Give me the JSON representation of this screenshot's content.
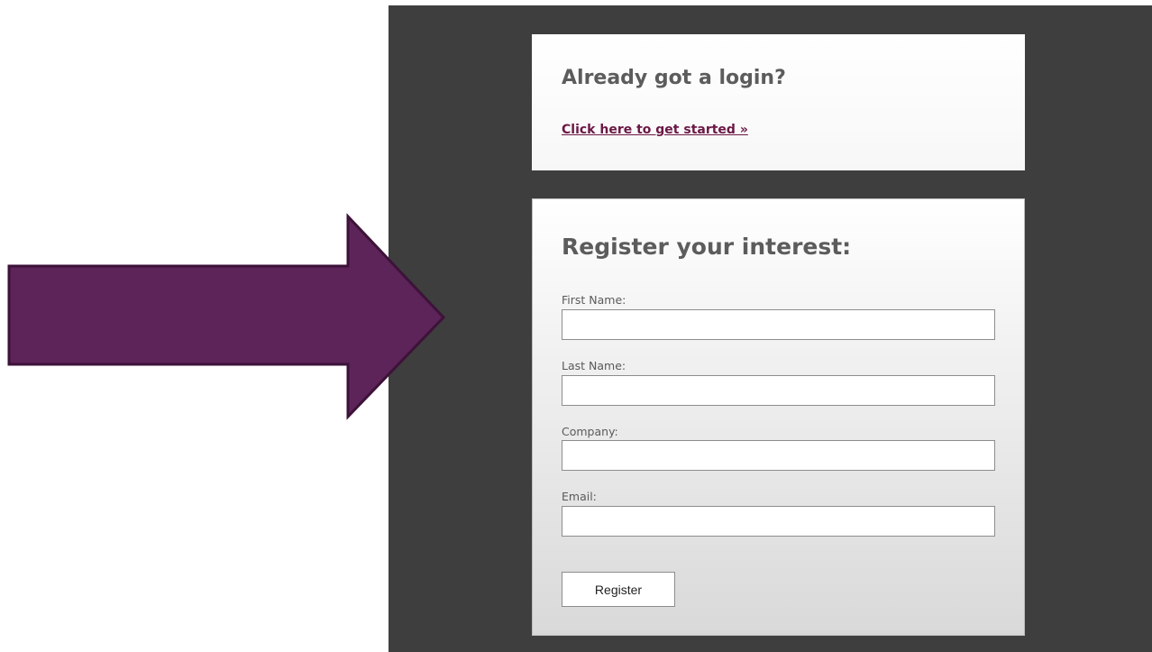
{
  "login_card": {
    "heading": "Already got a login?",
    "link": "Click here to get started »"
  },
  "register_card": {
    "heading": "Register your interest:",
    "fields": [
      {
        "label": "First Name:",
        "value": ""
      },
      {
        "label": "Last Name:",
        "value": ""
      },
      {
        "label": "Company:",
        "value": ""
      },
      {
        "label": "Email:",
        "value": ""
      }
    ],
    "submit_label": "Register"
  },
  "colors": {
    "arrow_fill": "#5c2458",
    "arrow_stroke": "#3d1239",
    "panel_background": "#3e3e3e",
    "link_color": "#6b1845",
    "heading_color": "#5c5c5c"
  },
  "icons": {
    "pointer": "right-arrow-icon"
  }
}
